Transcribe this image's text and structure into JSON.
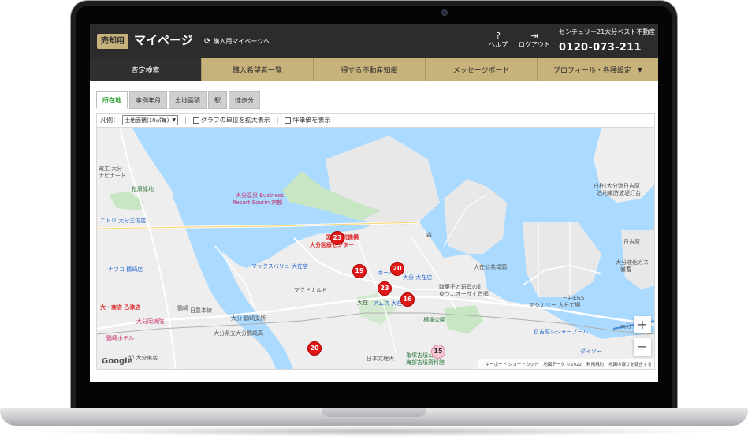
{
  "header": {
    "mode_badge": "売却用",
    "title": "マイページ",
    "switch_link": "購入用マイページへ",
    "help_label": "ヘルプ",
    "logout_label": "ログアウト",
    "company_name": "センチュリー21大分ベスト不動産",
    "phone": "0120-073-211"
  },
  "nav": {
    "items": [
      {
        "label": "査定検索",
        "active": true
      },
      {
        "label": "購入希望者一覧"
      },
      {
        "label": "得する不動産知識"
      },
      {
        "label": "メッセージボード"
      },
      {
        "label": "プロフィール・各種設定"
      }
    ]
  },
  "tabs": [
    {
      "label": "所在地",
      "active": true
    },
    {
      "label": "事例年月"
    },
    {
      "label": "土地面積"
    },
    {
      "label": "駅"
    },
    {
      "label": "徒歩分"
    }
  ],
  "legend": {
    "label": "凡例：",
    "select_value": "土地面積(10㎡毎)",
    "checkbox1": "グラフの単位を拡大表示",
    "checkbox2": "坪単価を表示"
  },
  "map": {
    "labels": {
      "l1": "電工 大分",
      "l2": "ナビナート",
      "l3": "松原緑地",
      "l4": "ニトリ 大分三佐店",
      "l5": "ナフコ 鶴崎店",
      "l6": "大分温泉 Business",
      "l7": "Resort Sourin 宗麟",
      "l8": "国立病院機構",
      "l9": "大分医療センター",
      "l10": "マックスバリュ 大在店",
      "l11": "マクドナルド",
      "l12": "大在公共埠頭",
      "l13": "駄菓子と玩具の町",
      "l14": "ゆう…オーザイ首邸",
      "l15": "横塚公園",
      "l16": "日吉原レジャープール",
      "l17": "ダイソー",
      "l18": "大分液化ガス",
      "l19": "備蓄",
      "l20": "三井E&S",
      "l21": "マシナリー 大分工場",
      "l22": "大一商店 乙津店",
      "l23": "大分岡病院",
      "l24": "鶴崎ホテル",
      "l25": "大分 鶴崎支所",
      "l26": "大分県立大分鶴崎高",
      "l27": "日本文理大",
      "l28": "亀塚古墳公園",
      "l29": "海部古墳資料館",
      "l30": "大分 日吉原",
      "l31": "日吉原",
      "l32": "白杵(大分港日吉原",
      "l33": "泊地東防波堤灯台",
      "l34": "鶴崎",
      "l35": "大在",
      "l36": "アムス 大在",
      "l37": "大分 大在店",
      "l38": "日豊本線",
      "l39": "ホーム",
      "l40": "森",
      "l41": "卸 大分東店"
    },
    "clusters": [
      {
        "label": "23",
        "pink": false
      },
      {
        "label": "19",
        "pink": false
      },
      {
        "label": "20",
        "pink": false
      },
      {
        "label": "23",
        "pink": false
      },
      {
        "label": "16",
        "pink": false
      },
      {
        "label": "20",
        "pink": false
      },
      {
        "label": "15",
        "pink": true
      }
    ],
    "zoom_in": "+",
    "zoom_out": "−",
    "google": "Google",
    "attribution": {
      "shortcut": "キーボード ショートカット",
      "data": "地図データ ©2022",
      "terms": "利用規約",
      "report": "地図の誤りを報告する"
    }
  },
  "colors": {
    "header_bg": "#2c2c2c",
    "gold": "#c8b27c",
    "active_tab_text": "#2ea02e",
    "cluster_red": "#e01818",
    "water": "#aadaff"
  }
}
